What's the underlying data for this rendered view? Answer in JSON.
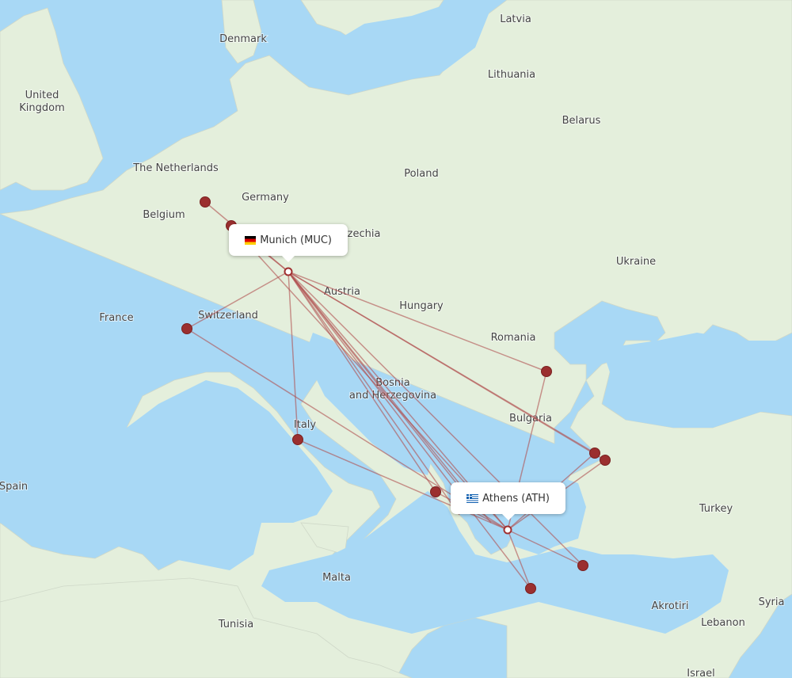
{
  "map": {
    "colors": {
      "water": "#a8d8f5",
      "land": "#e4efdc",
      "route": "#b05050",
      "destination_marker": "#9b2f2f",
      "hub_marker_fill": "#ffffff"
    },
    "country_labels": [
      {
        "id": "denmark",
        "text": "Denmark"
      },
      {
        "id": "latvia",
        "text": "Latvia"
      },
      {
        "id": "lithuania",
        "text": "Lithuania"
      },
      {
        "id": "united-kingdom-1",
        "text": "United"
      },
      {
        "id": "united-kingdom-2",
        "text": "Kingdom"
      },
      {
        "id": "belarus",
        "text": "Belarus"
      },
      {
        "id": "netherlands",
        "text": "The Netherlands"
      },
      {
        "id": "poland",
        "text": "Poland"
      },
      {
        "id": "germany",
        "text": "Germany"
      },
      {
        "id": "belgium",
        "text": "Belgium"
      },
      {
        "id": "czechia",
        "text": "Czechia"
      },
      {
        "id": "ukraine",
        "text": "Ukraine"
      },
      {
        "id": "austria",
        "text": "Austria"
      },
      {
        "id": "france",
        "text": "France"
      },
      {
        "id": "switzerland",
        "text": "Switzerland"
      },
      {
        "id": "hungary",
        "text": "Hungary"
      },
      {
        "id": "romania",
        "text": "Romania"
      },
      {
        "id": "bosnia-1",
        "text": "Bosnia"
      },
      {
        "id": "bosnia-2",
        "text": "and Herzegovina"
      },
      {
        "id": "bulgaria",
        "text": "Bulgaria"
      },
      {
        "id": "italy",
        "text": "Italy"
      },
      {
        "id": "spain",
        "text": "Spain"
      },
      {
        "id": "turkey",
        "text": "Turkey"
      },
      {
        "id": "malta",
        "text": "Malta"
      },
      {
        "id": "tunisia",
        "text": "Tunisia"
      },
      {
        "id": "akrotiri",
        "text": "Akrotiri"
      },
      {
        "id": "syria",
        "text": "Syria"
      },
      {
        "id": "lebanon",
        "text": "Lebanon"
      },
      {
        "id": "israel",
        "text": "Israel"
      }
    ],
    "airports": {
      "origin": {
        "label": "Munich (MUC)",
        "flag": "germany-flag"
      },
      "destination": {
        "label": "Athens (ATH)",
        "flag": "greece-flag"
      }
    },
    "destination_markers": [
      "frankfurt-area-1",
      "frankfurt-area-2",
      "geneva",
      "rome",
      "western-greece",
      "bucharest",
      "istanbul-1",
      "istanbul-2",
      "crete",
      "rhodes"
    ]
  }
}
